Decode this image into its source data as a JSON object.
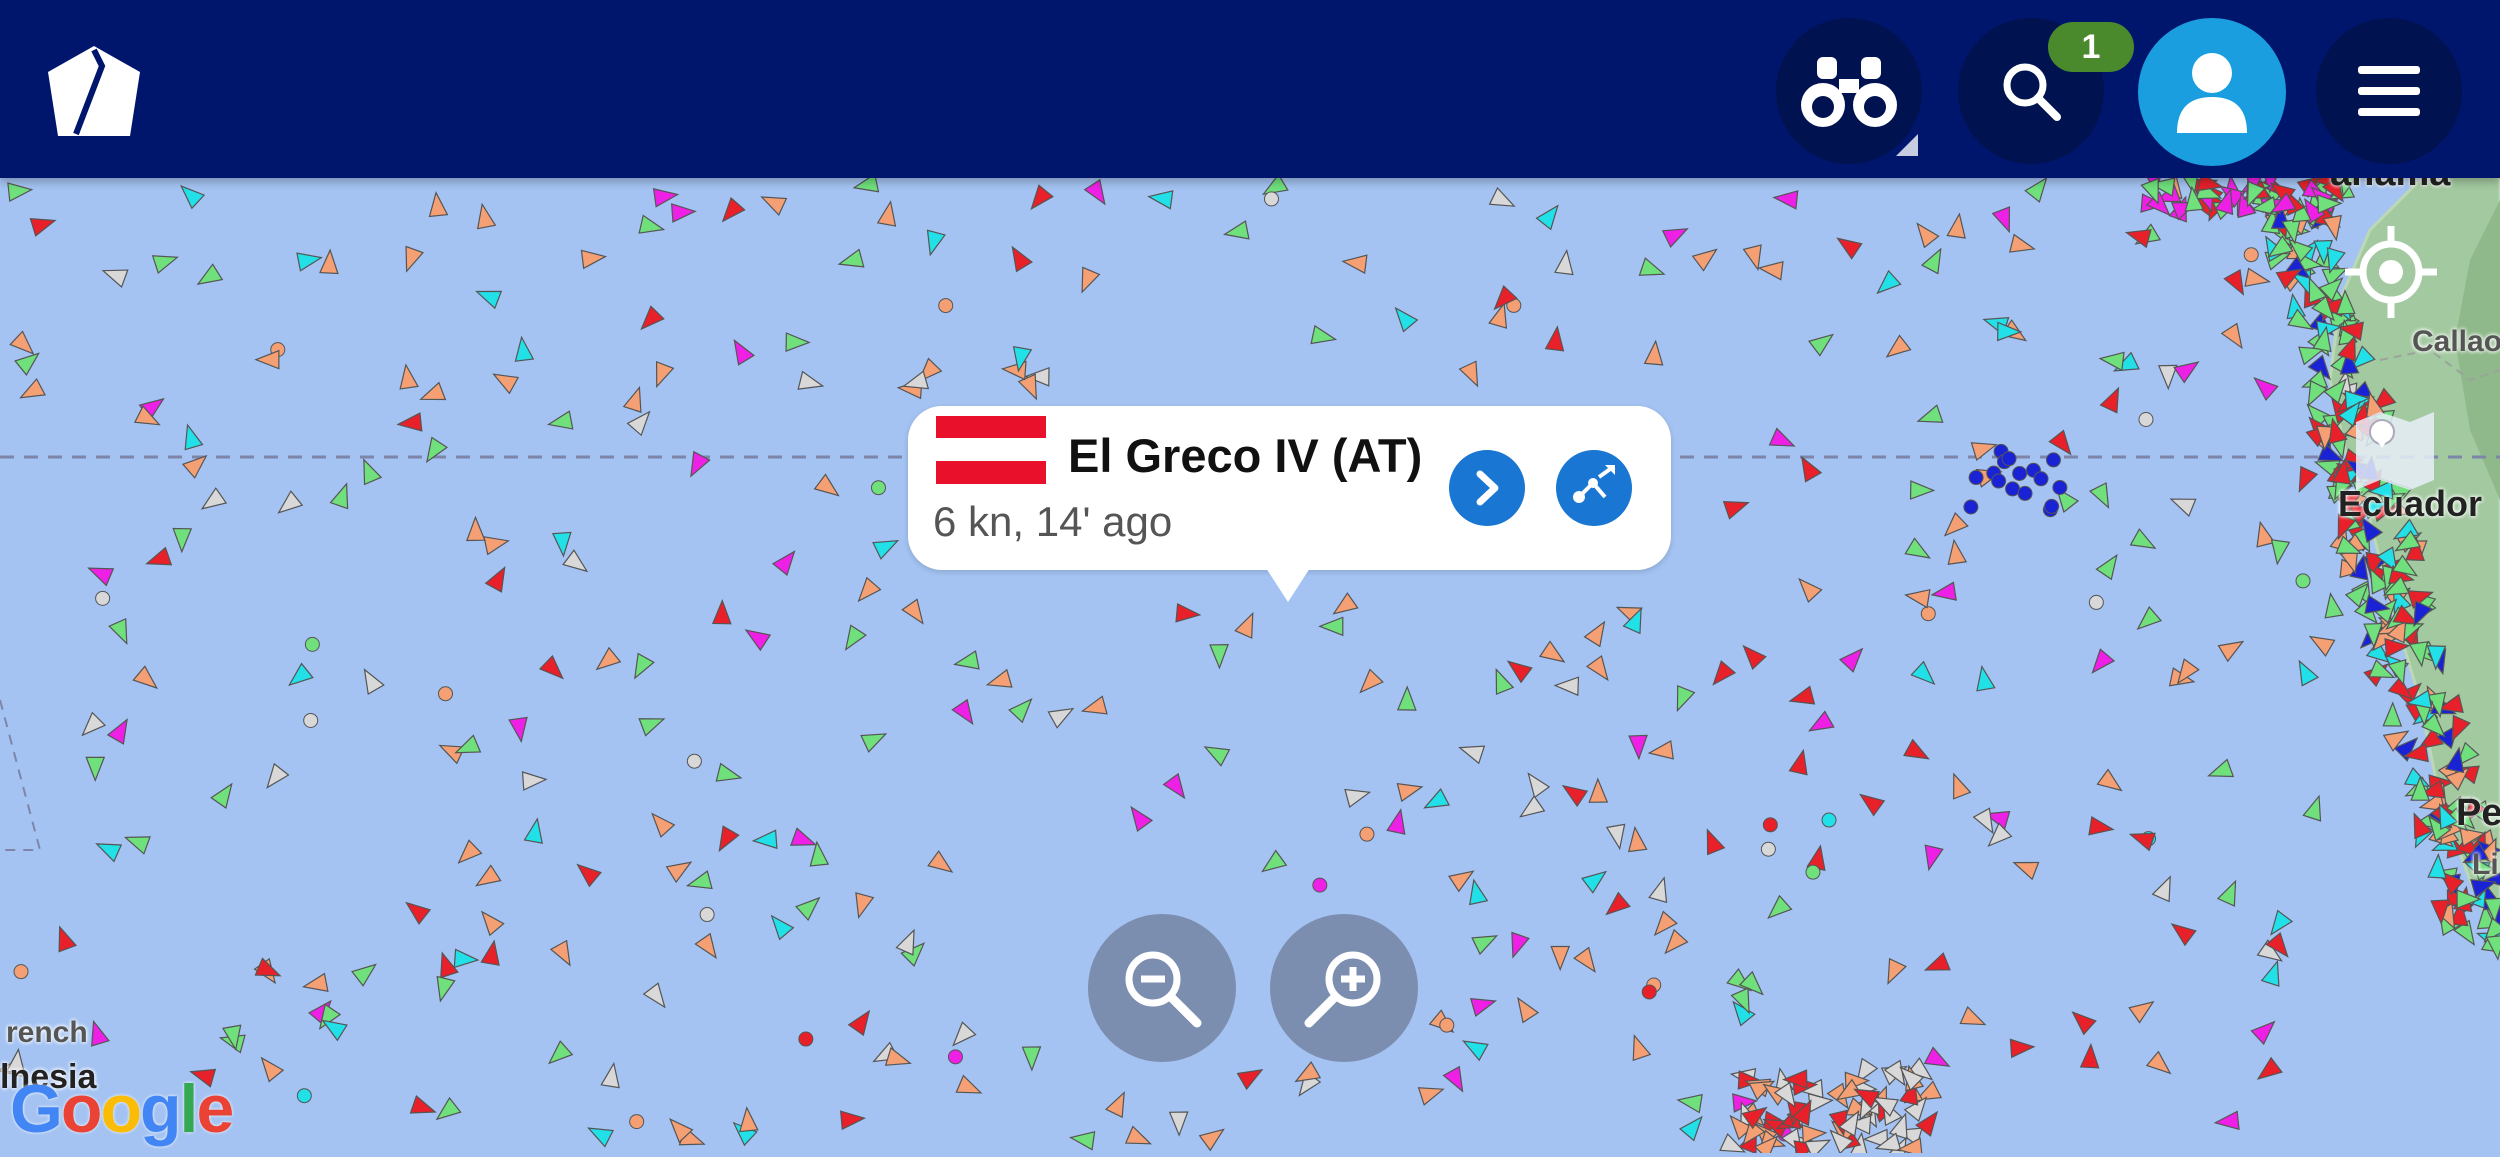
{
  "header": {
    "logo_icon": "home-pentagon-icon",
    "binoculars_icon": "binoculars-icon",
    "search_icon": "search-icon",
    "search_badge": "1",
    "profile_icon": "user-avatar-icon",
    "menu_icon": "hamburger-menu-icon"
  },
  "vessel_popup": {
    "flag": "Austria",
    "name": "El Greco IV (AT)",
    "status": "6 kn, 14' ago",
    "details_icon": "chevron-right-icon",
    "route_icon": "route-icon"
  },
  "map_controls": {
    "locate_icon": "crosshair-locate-icon",
    "layers_icon": "map-layers-icon",
    "zoom_out_icon": "zoom-out-icon",
    "zoom_in_icon": "zoom-in-icon"
  },
  "map_labels": {
    "ecuador": "Ecuador",
    "callao": "Callao",
    "panama": "anama",
    "peru": "Pe",
    "lima": "Li",
    "polynesia": "lnesia",
    "french": "rench",
    "google": "Google"
  },
  "colors": {
    "header_bg": "#00166d",
    "ocean": "#a4c3f2",
    "cargo_green": "#6fe07c",
    "tanker_red": "#e8202a",
    "fishing_orange": "#f4a074",
    "passenger_blue": "#1a22d6",
    "pleasure_magenta": "#ee20e6",
    "unspecified_grey": "#d8d8d8",
    "tug_cyan": "#22e0e8",
    "accent_blue": "#1976d2",
    "profile_blue": "#1a9ee0",
    "badge_green": "#4a8a2c"
  }
}
